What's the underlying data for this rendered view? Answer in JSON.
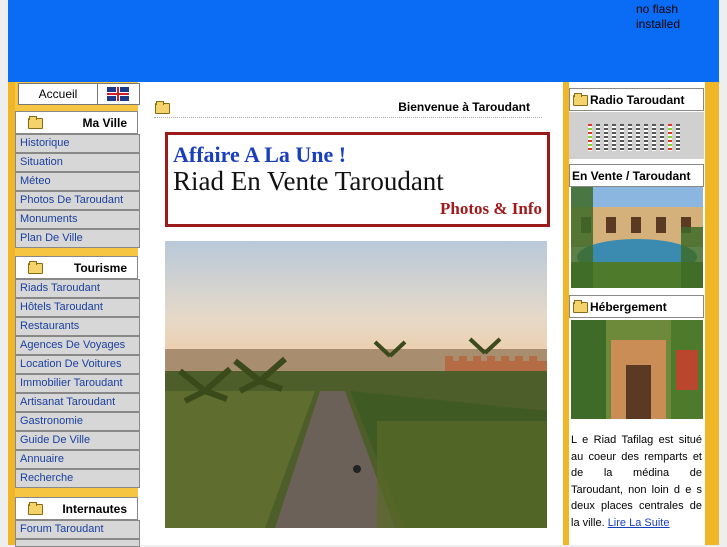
{
  "flash_notice": "no flash installed",
  "topnav": {
    "home": "Accueil",
    "lang_icon": "uk-flag-icon"
  },
  "left_menu": [
    {
      "title": "Ma Ville",
      "items": [
        "Historique",
        "Situation",
        "Méteo",
        "Photos De Taroudant",
        "Monuments",
        "Plan De Ville"
      ]
    },
    {
      "title": "Tourisme",
      "items": [
        "Riads Taroudant",
        "Hôtels Taroudant",
        "Restaurants",
        "Agences De Voyages",
        "Location De Voitures",
        "Immobilier Taroudant",
        "Artisanat Taroudant",
        "Gastronomie",
        "Guide De Ville",
        "Annuaire",
        "Recherche"
      ]
    },
    {
      "title": "Internautes",
      "items": [
        "Forum Taroudant"
      ]
    }
  ],
  "main": {
    "heading": "Bienvenue à Taroudant",
    "banner": {
      "line1": "Affaire A La Une !",
      "line2": "Riad En Vente Taroudant",
      "line3": "Photos & Info"
    }
  },
  "right": {
    "radio_title": "Radio Taroudant",
    "vente_title": "En Vente / Taroudant",
    "heb_title": "Hébergement",
    "heb_text": "L e Riad Tafilag est situé au coeur des remparts et de la médina de Taroudant, non loin d e s deux places centrales de la ville.",
    "heb_link": "Lire La Suite"
  },
  "colors": {
    "top_blue": "#0a6cf5",
    "side_gold": "#f0b627",
    "banner_red": "#9b1b1b",
    "link_blue": "#1a3fa0"
  }
}
